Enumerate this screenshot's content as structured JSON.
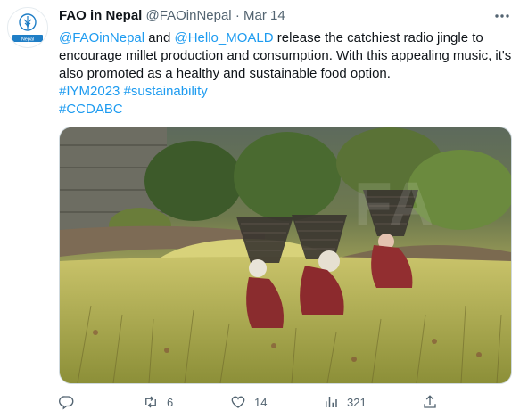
{
  "author": {
    "name": "FAO in Nepal",
    "handle": "@FAOinNepal",
    "separator": "·",
    "date": "Mar 14",
    "avatar_label": "Nepal"
  },
  "tweet": {
    "mention_1": "@FAOinNepal",
    "and_text": " and ",
    "mention_2": "@Hello_MOALD",
    "body": " release the catchiest radio jingle to encourage millet production and consumption. With this appealing music, it's also promoted as a healthy and sustainable food option.",
    "hashtag_1": "#IYM2023",
    "hashtag_2": "#sustainability",
    "hashtag_3": "#CCDABC"
  },
  "actions": {
    "reply_icon": "reply-icon",
    "retweet_icon": "retweet-icon",
    "retweet_count": "6",
    "like_icon": "heart-icon",
    "like_count": "14",
    "views_icon": "views-icon",
    "views_count": "321",
    "share_icon": "share-icon"
  },
  "colors": {
    "link": "#1d9bf0",
    "secondary_text": "#536471",
    "avatar_brand": "#1f7ec6"
  }
}
